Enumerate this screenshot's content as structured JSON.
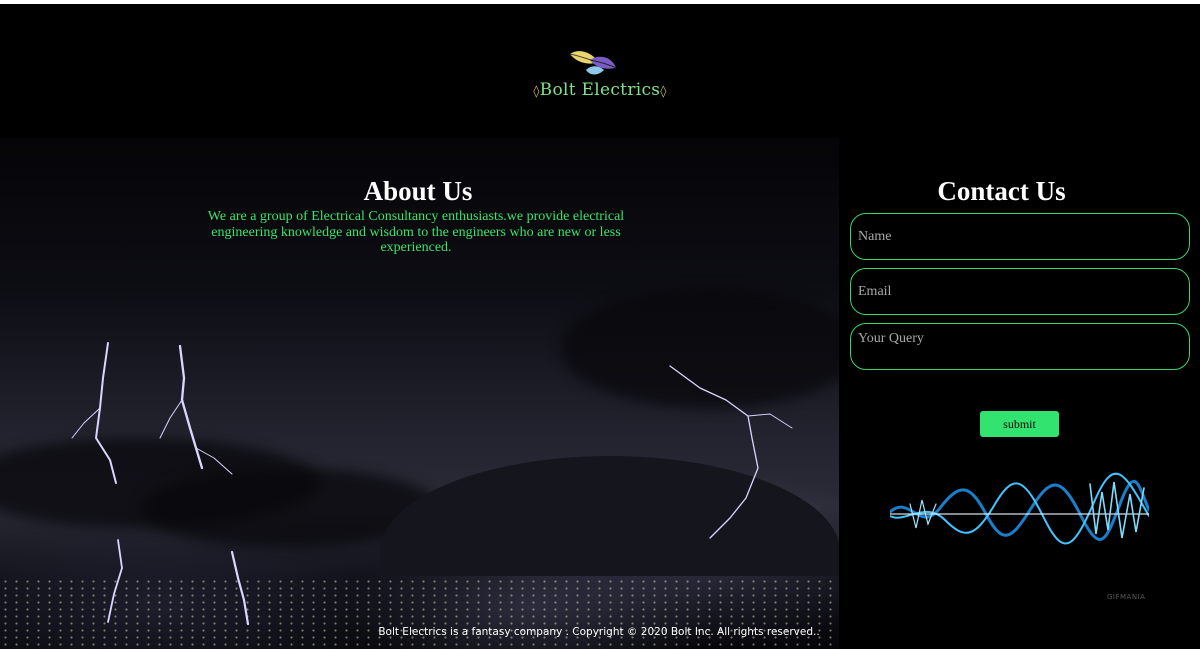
{
  "header": {
    "brand_name": "Bolt Electrics",
    "brand_prefix": "◊",
    "brand_suffix": "◊",
    "logo_icon": "leaves-icon"
  },
  "about": {
    "title": "About Us",
    "text": "We are a group of Electrical Consultancy enthusiasts.we provide electrical engineering knowledge and wisdom to the engineers who are new or less experienced."
  },
  "contact": {
    "title": "Contact Us",
    "name_placeholder": "Name",
    "email_placeholder": "Email",
    "query_placeholder": "Your Query",
    "submit_label": "submit",
    "watermark": "GIFMANIA"
  },
  "footer": {
    "text": "Bolt Electrics is a fantasy company . Copyright © 2020 Bolt Inc. All rights reserved.."
  },
  "colors": {
    "accent_green": "#33e36f",
    "brand_green": "#7ee38a",
    "background": "#000000"
  }
}
